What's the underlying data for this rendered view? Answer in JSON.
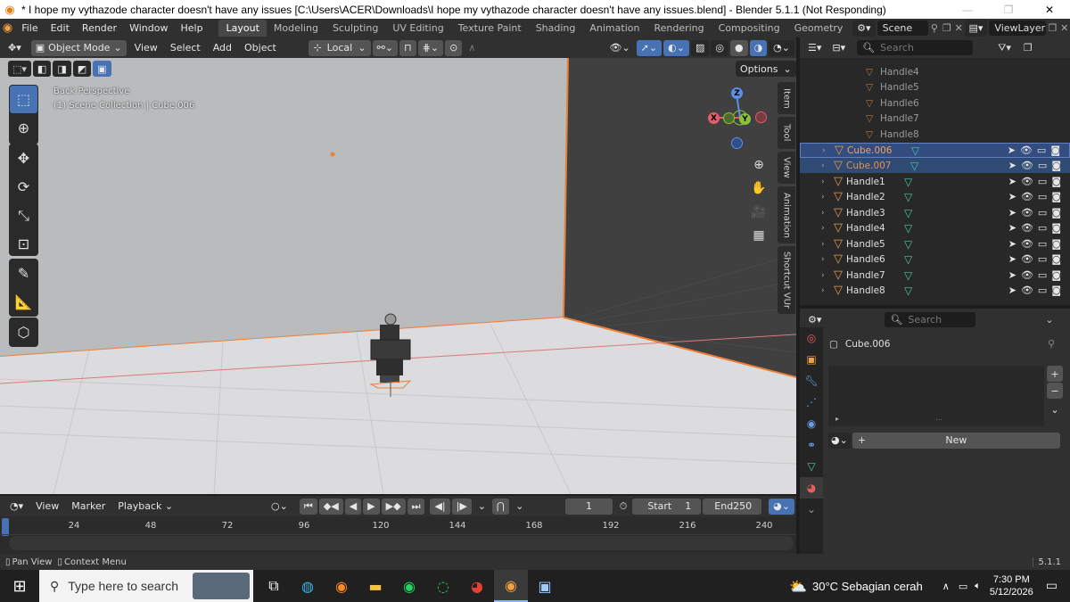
{
  "window": {
    "title": "* I hope my vythazode character doesn't have any issues [C:\\Users\\ACER\\Downloads\\I hope my vythazode character doesn't have any issues.blend] - Blender 5.1.1 (Not Responding)",
    "minimize": "—",
    "maximize": "❐",
    "close": "✕"
  },
  "menu": [
    "File",
    "Edit",
    "Render",
    "Window",
    "Help"
  ],
  "workspaces": [
    "Layout",
    "Modeling",
    "Sculpting",
    "UV Editing",
    "Texture Paint",
    "Shading",
    "Animation",
    "Rendering",
    "Compositing",
    "Geometry Nodes"
  ],
  "scene": {
    "name": "Scene",
    "view_layer": "ViewLayer"
  },
  "viewport_header": {
    "mode": "Object Mode",
    "menus": [
      "View",
      "Select",
      "Add",
      "Object"
    ],
    "transform_orientation": "Local",
    "options": "Options"
  },
  "viewport": {
    "view_name": "Back Perspective",
    "collection_info": "(1) Scene Collection | Cube.006",
    "side_tabs": [
      "Item",
      "Tool",
      "View",
      "Animation",
      "Shortcut VUr"
    ],
    "gizmo": {
      "x": "X",
      "y": "Y",
      "z": "Z"
    }
  },
  "outliner": {
    "search_placeholder": "Search",
    "faded_rows": [
      "Handle4",
      "Handle5",
      "Handle6",
      "Handle7",
      "Handle8"
    ],
    "rows": [
      {
        "name": "Cube.006",
        "selected": "active"
      },
      {
        "name": "Cube.007",
        "selected": "yes"
      },
      {
        "name": "Handle1",
        "selected": "no"
      },
      {
        "name": "Handle2",
        "selected": "no"
      },
      {
        "name": "Handle3",
        "selected": "no"
      },
      {
        "name": "Handle4",
        "selected": "no"
      },
      {
        "name": "Handle5",
        "selected": "no"
      },
      {
        "name": "Handle6",
        "selected": "no"
      },
      {
        "name": "Handle7",
        "selected": "no"
      },
      {
        "name": "Handle8",
        "selected": "no"
      }
    ]
  },
  "properties": {
    "search_placeholder": "Search",
    "object_name": "Cube.006",
    "new_button": "New",
    "plus": "+",
    "minus": "−"
  },
  "timeline": {
    "menus": [
      "View",
      "Marker",
      "Playback"
    ],
    "current_frame": "1",
    "start_label": "Start",
    "start": "1",
    "end_label": "End",
    "end": "250",
    "ticks": [
      "24",
      "48",
      "72",
      "96",
      "120",
      "144",
      "168",
      "192",
      "216",
      "240"
    ]
  },
  "statusbar": {
    "pan_view": "Pan View",
    "context_menu": "Context Menu",
    "version": "5.1.1"
  },
  "taskbar": {
    "search_placeholder": "Type here to search",
    "weather": "30°C  Sebagian cerah",
    "time": "7:30 PM",
    "date": "5/12/2026"
  }
}
